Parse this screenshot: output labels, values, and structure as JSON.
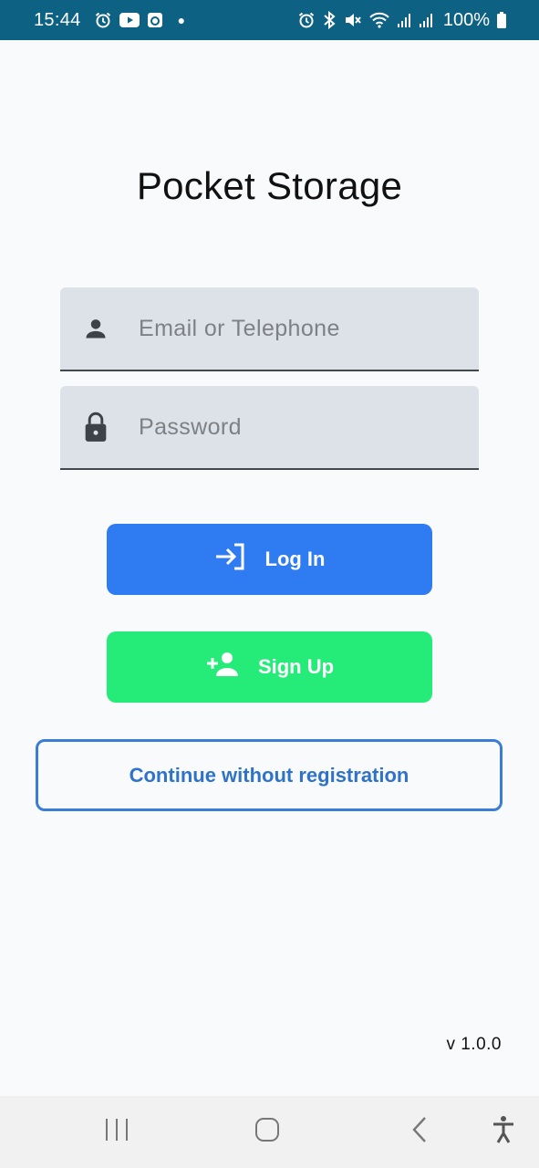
{
  "status_bar": {
    "time": "15:44",
    "battery": "100%",
    "left_icons": [
      "alarm-icon",
      "youtube-icon",
      "app-notification-icon",
      "dot-icon"
    ],
    "right_icons": [
      "alarm-icon",
      "bluetooth-icon",
      "mute-icon",
      "wifi-icon",
      "signal-icon",
      "signal-icon",
      "battery-icon"
    ],
    "background": "#0d6283"
  },
  "app": {
    "title": "Pocket Storage",
    "version": "v 1.0.0"
  },
  "form": {
    "email": {
      "placeholder": "Email or Telephone",
      "value": "",
      "icon": "person-icon"
    },
    "password": {
      "placeholder": "Password",
      "value": "",
      "icon": "lock-icon"
    }
  },
  "buttons": {
    "login": {
      "label": "Log In",
      "icon": "login-icon",
      "color": "#2f7bf1"
    },
    "signup": {
      "label": "Sign Up",
      "icon": "person-add-icon",
      "color": "#25ec78"
    },
    "continue": {
      "label": "Continue without registration",
      "color": "#2f72c9"
    }
  },
  "nav_bar": {
    "items": [
      "recent-apps-icon",
      "home-icon",
      "back-icon",
      "accessibility-icon"
    ]
  }
}
